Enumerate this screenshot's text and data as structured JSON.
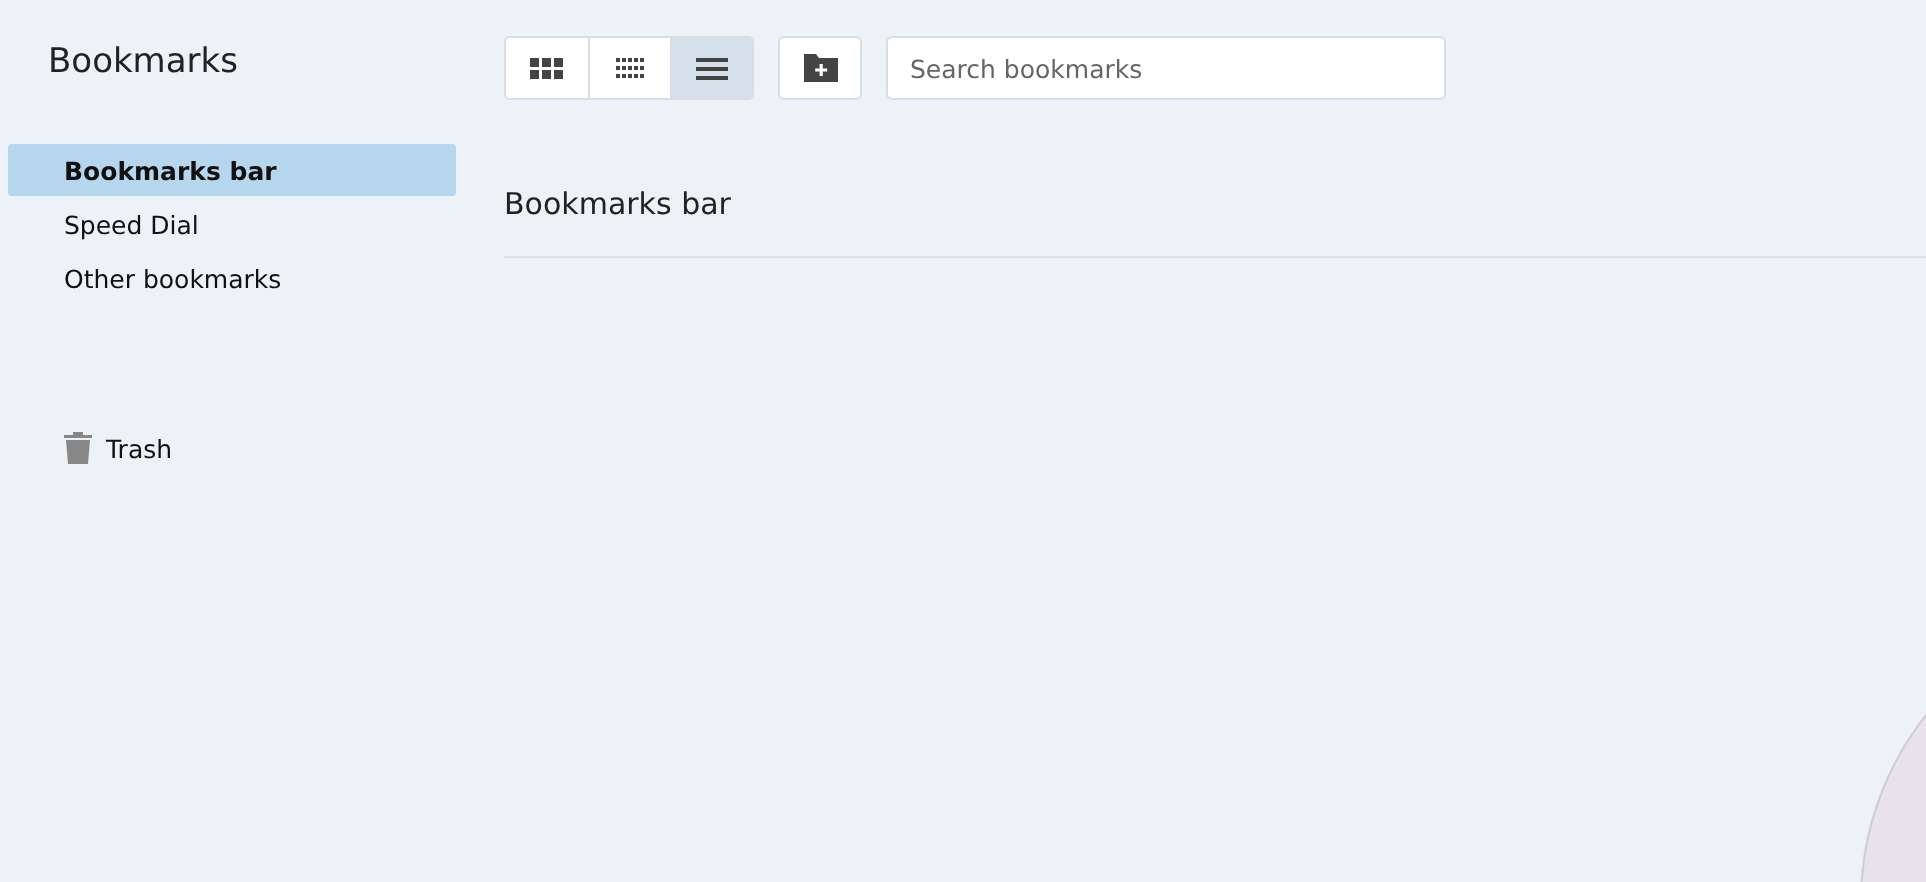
{
  "sidebar": {
    "title": "Bookmarks",
    "items": [
      {
        "label": "Bookmarks bar",
        "selected": true
      },
      {
        "label": "Speed Dial",
        "selected": false
      },
      {
        "label": "Other bookmarks",
        "selected": false
      }
    ],
    "trash": {
      "label": "Trash"
    }
  },
  "toolbar": {
    "views": [
      {
        "kind": "large-grid",
        "selected": false
      },
      {
        "kind": "small-grid",
        "selected": false
      },
      {
        "kind": "list",
        "selected": true
      }
    ],
    "search": {
      "placeholder": "Search bookmarks"
    }
  },
  "content": {
    "heading": "Bookmarks bar"
  }
}
